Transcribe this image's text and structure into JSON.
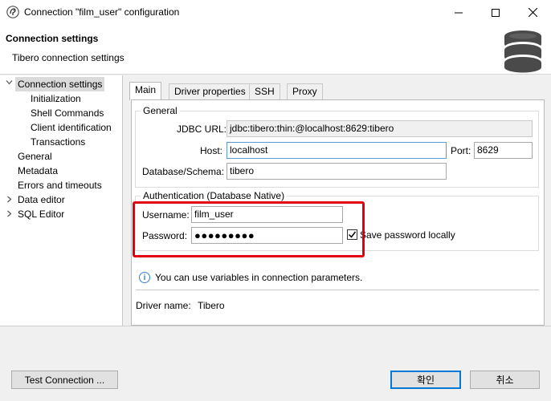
{
  "window": {
    "title": "Connection \"film_user\" configuration"
  },
  "header": {
    "title": "Connection settings",
    "subtitle": "Tibero connection settings"
  },
  "tree": {
    "connection_settings": "Connection settings",
    "initialization": "Initialization",
    "shell_commands": "Shell Commands",
    "client_identification": "Client identification",
    "transactions": "Transactions",
    "general": "General",
    "metadata": "Metadata",
    "errors_timeouts": "Errors and timeouts",
    "data_editor": "Data editor",
    "sql_editor": "SQL Editor"
  },
  "tabs": {
    "main": "Main",
    "driver_properties": "Driver properties",
    "ssh": "SSH",
    "proxy": "Proxy"
  },
  "general": {
    "legend": "General",
    "jdbc_label": "JDBC URL:",
    "jdbc_value": "jdbc:tibero:thin:@localhost:8629:tibero",
    "host_label": "Host:",
    "host_value": "localhost",
    "port_label": "Port:",
    "port_value": "8629",
    "db_label": "Database/Schema:",
    "db_value": "tibero"
  },
  "auth": {
    "legend": "Authentication (Database Native)",
    "username_label": "Username:",
    "username_value": "film_user",
    "password_label": "Password:",
    "password_value": "●●●●●●●●●",
    "save_password_label": "Save password locally",
    "save_password_checked": true
  },
  "info": {
    "text": "You can use variables in connection parameters."
  },
  "driver": {
    "label": "Driver name:",
    "value": "Tibero"
  },
  "buttons": {
    "test_connection": "Test Connection ...",
    "ok": "확인",
    "cancel": "취소"
  },
  "icons": {
    "app": "app-icon",
    "minimize": "minimize-icon",
    "maximize": "maximize-icon",
    "close": "close-icon",
    "database": "database-icon",
    "info": "info-icon",
    "expand": "chevron-right-icon",
    "collapse": "chevron-down-icon",
    "check": "checkmark-icon"
  },
  "colors": {
    "highlight_box": "#e00012",
    "focus_border": "#5b9bd5",
    "default_button_border": "#0078d7"
  }
}
